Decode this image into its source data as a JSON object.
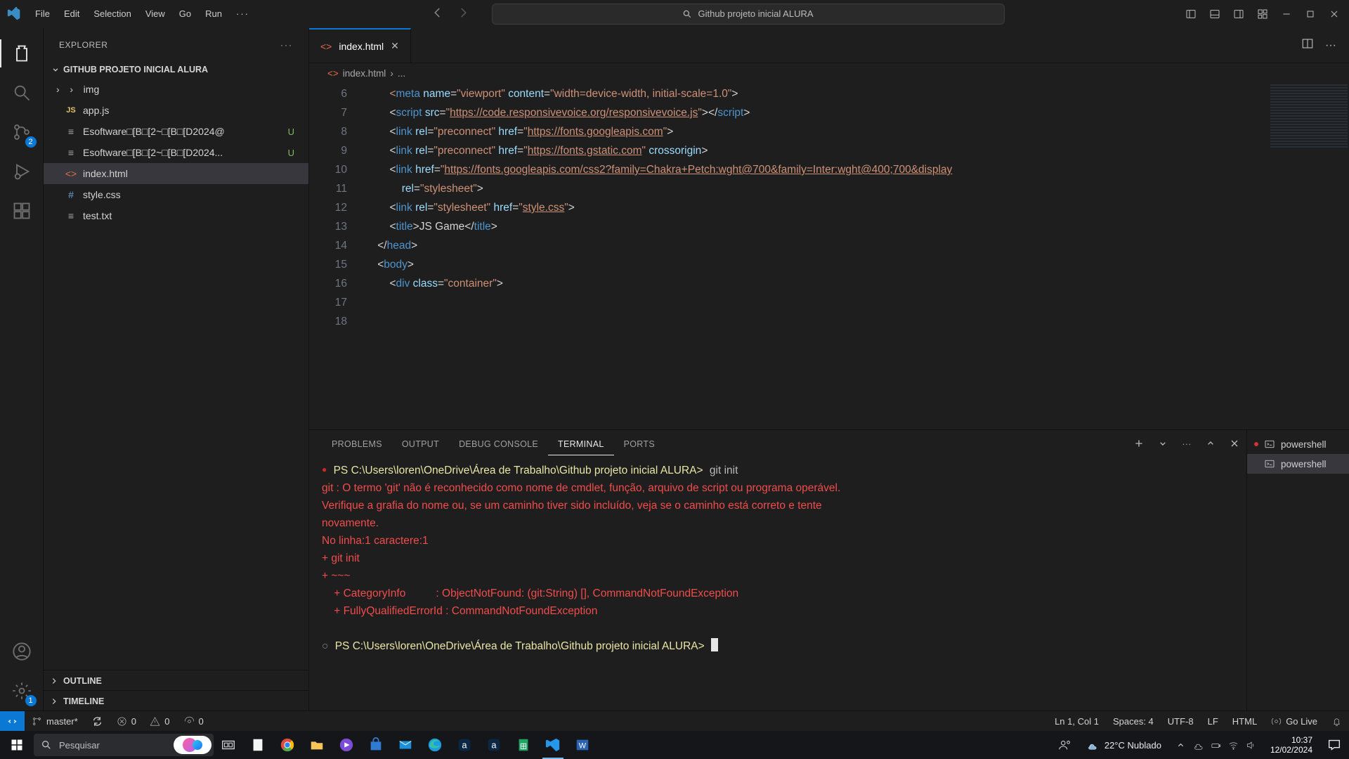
{
  "titlebar": {
    "menus": [
      "File",
      "Edit",
      "Selection",
      "View",
      "Go",
      "Run"
    ],
    "ellipsis": "···",
    "search_placeholder": "Github projeto inicial ALURA"
  },
  "activity_badges": {
    "scm": "2",
    "settings": "1"
  },
  "sidebar": {
    "header": "EXPLORER",
    "header_more": "···",
    "folder": "GITHUB PROJETO INICIAL ALURA",
    "items": [
      {
        "type": "dir",
        "name": "img"
      },
      {
        "type": "js",
        "name": "app.js"
      },
      {
        "type": "file",
        "name": "Esoftware□[B□[2~□[B□[D2024@",
        "status": "U"
      },
      {
        "type": "file",
        "name": "Esoftware□[B□[2~□[B□[D2024...",
        "status": "U"
      },
      {
        "type": "html",
        "name": "index.html",
        "selected": true
      },
      {
        "type": "css",
        "name": "style.css"
      },
      {
        "type": "txt",
        "name": "test.txt"
      }
    ],
    "outline": "OUTLINE",
    "timeline": "TIMELINE"
  },
  "editor": {
    "tab": {
      "name": "index.html"
    },
    "breadcrumb": {
      "file": "index.html",
      "more": "..."
    },
    "tabbar_more": "···",
    "line_start": 6,
    "lines": [
      [
        {
          "c": "t-str",
          "t": "        <"
        },
        {
          "c": "t-tag",
          "t": "meta"
        },
        {
          "c": "",
          "t": " "
        },
        {
          "c": "t-attr",
          "t": "name"
        },
        {
          "c": "",
          "t": "="
        },
        {
          "c": "t-str",
          "t": "\"viewport\""
        },
        {
          "c": "",
          "t": " "
        },
        {
          "c": "t-attr",
          "t": "content"
        },
        {
          "c": "",
          "t": "="
        },
        {
          "c": "t-str",
          "t": "\"width=device-width, initial-scale=1.0\""
        },
        {
          "c": "",
          "t": ">"
        }
      ],
      [
        {
          "c": "",
          "t": "        <"
        },
        {
          "c": "t-tag",
          "t": "script"
        },
        {
          "c": "",
          "t": " "
        },
        {
          "c": "t-attr",
          "t": "src"
        },
        {
          "c": "",
          "t": "="
        },
        {
          "c": "t-str",
          "t": "\""
        },
        {
          "c": "t-url",
          "t": "https://code.responsivevoice.org/responsivevoice.js"
        },
        {
          "c": "t-str",
          "t": "\""
        },
        {
          "c": "",
          "t": "></"
        },
        {
          "c": "t-tag",
          "t": "script"
        },
        {
          "c": "",
          "t": ">"
        }
      ],
      [
        {
          "c": "",
          "t": "        <"
        },
        {
          "c": "t-tag",
          "t": "link"
        },
        {
          "c": "",
          "t": " "
        },
        {
          "c": "t-attr",
          "t": "rel"
        },
        {
          "c": "",
          "t": "="
        },
        {
          "c": "t-str",
          "t": "\"preconnect\""
        },
        {
          "c": "",
          "t": " "
        },
        {
          "c": "t-attr",
          "t": "href"
        },
        {
          "c": "",
          "t": "="
        },
        {
          "c": "t-str",
          "t": "\""
        },
        {
          "c": "t-url",
          "t": "https://fonts.googleapis.com"
        },
        {
          "c": "t-str",
          "t": "\""
        },
        {
          "c": "",
          "t": ">"
        }
      ],
      [
        {
          "c": "",
          "t": "        <"
        },
        {
          "c": "t-tag",
          "t": "link"
        },
        {
          "c": "",
          "t": " "
        },
        {
          "c": "t-attr",
          "t": "rel"
        },
        {
          "c": "",
          "t": "="
        },
        {
          "c": "t-str",
          "t": "\"preconnect\""
        },
        {
          "c": "",
          "t": " "
        },
        {
          "c": "t-attr",
          "t": "href"
        },
        {
          "c": "",
          "t": "="
        },
        {
          "c": "t-str",
          "t": "\""
        },
        {
          "c": "t-url",
          "t": "https://fonts.gstatic.com"
        },
        {
          "c": "t-str",
          "t": "\""
        },
        {
          "c": "",
          "t": " "
        },
        {
          "c": "t-attr",
          "t": "crossorigin"
        },
        {
          "c": "",
          "t": ">"
        }
      ],
      [
        {
          "c": "",
          "t": "        <"
        },
        {
          "c": "t-tag",
          "t": "link"
        },
        {
          "c": "",
          "t": " "
        },
        {
          "c": "t-attr",
          "t": "href"
        },
        {
          "c": "",
          "t": "="
        },
        {
          "c": "t-str",
          "t": "\""
        },
        {
          "c": "t-url",
          "t": "https://fonts.googleapis.com/css2?family=Chakra+Petch:wght@700&family=Inter:wght@400;700&display"
        },
        {
          "c": "",
          "t": ""
        }
      ],
      [
        {
          "c": "",
          "t": "            "
        },
        {
          "c": "t-attr",
          "t": "rel"
        },
        {
          "c": "",
          "t": "="
        },
        {
          "c": "t-str",
          "t": "\"stylesheet\""
        },
        {
          "c": "",
          "t": ">"
        }
      ],
      [
        {
          "c": "",
          "t": "        <"
        },
        {
          "c": "t-tag",
          "t": "link"
        },
        {
          "c": "",
          "t": " "
        },
        {
          "c": "t-attr",
          "t": "rel"
        },
        {
          "c": "",
          "t": "="
        },
        {
          "c": "t-str",
          "t": "\"stylesheet\""
        },
        {
          "c": "",
          "t": " "
        },
        {
          "c": "t-attr",
          "t": "href"
        },
        {
          "c": "",
          "t": "="
        },
        {
          "c": "t-str",
          "t": "\""
        },
        {
          "c": "t-url",
          "t": "style.css"
        },
        {
          "c": "t-str",
          "t": "\""
        },
        {
          "c": "",
          "t": ">"
        }
      ],
      [
        {
          "c": "",
          "t": "        <"
        },
        {
          "c": "t-tag",
          "t": "title"
        },
        {
          "c": "",
          "t": ">JS Game</"
        },
        {
          "c": "t-tag",
          "t": "title"
        },
        {
          "c": "",
          "t": ">"
        }
      ],
      [
        {
          "c": "",
          "t": "    </"
        },
        {
          "c": "t-tag",
          "t": "head"
        },
        {
          "c": "",
          "t": ">"
        }
      ],
      [
        {
          "c": "",
          "t": ""
        }
      ],
      [
        {
          "c": "",
          "t": "    <"
        },
        {
          "c": "t-tag",
          "t": "body"
        },
        {
          "c": "",
          "t": ">"
        }
      ],
      [
        {
          "c": "",
          "t": ""
        }
      ],
      [
        {
          "c": "",
          "t": "        <"
        },
        {
          "c": "t-tag",
          "t": "div"
        },
        {
          "c": "",
          "t": " "
        },
        {
          "c": "t-attr",
          "t": "class"
        },
        {
          "c": "",
          "t": "="
        },
        {
          "c": "t-str",
          "t": "\"container\""
        },
        {
          "c": "",
          "t": ">"
        }
      ]
    ]
  },
  "panel": {
    "tabs": [
      "PROBLEMS",
      "OUTPUT",
      "DEBUG CONSOLE",
      "TERMINAL",
      "PORTS"
    ],
    "active_tab": 3,
    "actions_more": "···",
    "terminals": [
      {
        "name": "powershell",
        "warn": true
      },
      {
        "name": "powershell",
        "active": true
      }
    ],
    "terminal": {
      "prompt": "PS C:\\Users\\loren\\OneDrive\\Área de Trabalho\\Github projeto inicial ALURA>",
      "cmd": "git init",
      "err1": "git : O termo 'git' não é reconhecido como nome de cmdlet, função, arquivo de script ou programa operável.",
      "err2": "Verifique a grafia do nome ou, se um caminho tiver sido incluído, veja se o caminho está correto e tente",
      "err3": "novamente.",
      "err4": "No linha:1 caractere:1",
      "err5": "+ git init",
      "err6": "+ ~~~",
      "err7": "    + CategoryInfo          : ObjectNotFound: (git:String) [], CommandNotFoundException",
      "err8": "    + FullyQualifiedErrorId : CommandNotFoundException"
    }
  },
  "statusbar": {
    "branch": "master*",
    "errors": "0",
    "warnings": "0",
    "ports": "0",
    "position": "Ln 1, Col 1",
    "spaces": "Spaces: 4",
    "encoding": "UTF-8",
    "eol": "LF",
    "lang": "HTML",
    "golive": "Go Live"
  },
  "taskbar": {
    "search": "Pesquisar",
    "weather": "22°C  Nublado",
    "clock": {
      "time": "10:37",
      "date": "12/02/2024"
    }
  }
}
